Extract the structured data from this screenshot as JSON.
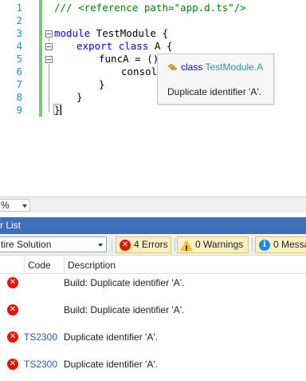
{
  "editor": {
    "line_numbers": [
      "1",
      "2",
      "3",
      "4",
      "5",
      "6",
      "7",
      "8",
      "9"
    ],
    "lines": {
      "l1_comment": "/// <reference path=\"app.d.ts\"/>",
      "l3_keyword": "module",
      "l3_name": " TestModule {",
      "l4_keyword1": "export",
      "l4_keyword2": "class",
      "l4_name": " A {",
      "l5_text": "funcA = ()",
      "l6_text": "console",
      "l7_text": "}",
      "l8_text": "}",
      "l9_text": "}"
    }
  },
  "tooltip": {
    "kind": "class",
    "qualified_name": "TestModule.A",
    "message": "Duplicate identifier 'A'.",
    "icon": "class-icon"
  },
  "zoom": {
    "value": "%"
  },
  "error_list": {
    "title": "r List",
    "scope": "tire Solution",
    "errors_label": "4 Errors",
    "warnings_label": "0 Warnings",
    "messages_label": "0 Messa",
    "columns": {
      "code": "Code",
      "description": "Description"
    },
    "rows": [
      {
        "code": "",
        "description": "Build: Duplicate identifier 'A'."
      },
      {
        "code": "",
        "description": "Build: Duplicate identifier 'A'."
      },
      {
        "code": "TS2300",
        "description": "Duplicate identifier 'A'."
      },
      {
        "code": "TS2300",
        "description": "Duplicate identifier 'A'."
      }
    ]
  },
  "colors": {
    "keyword": "#0000ff",
    "comment": "#008000",
    "type": "#2b91af",
    "line_number": "#2b91af",
    "change_bar": "#6bd06b",
    "panel_title": "#3e6fb8",
    "error": "#e51400",
    "warning": "#f2c12e",
    "info": "#1e88e5"
  }
}
